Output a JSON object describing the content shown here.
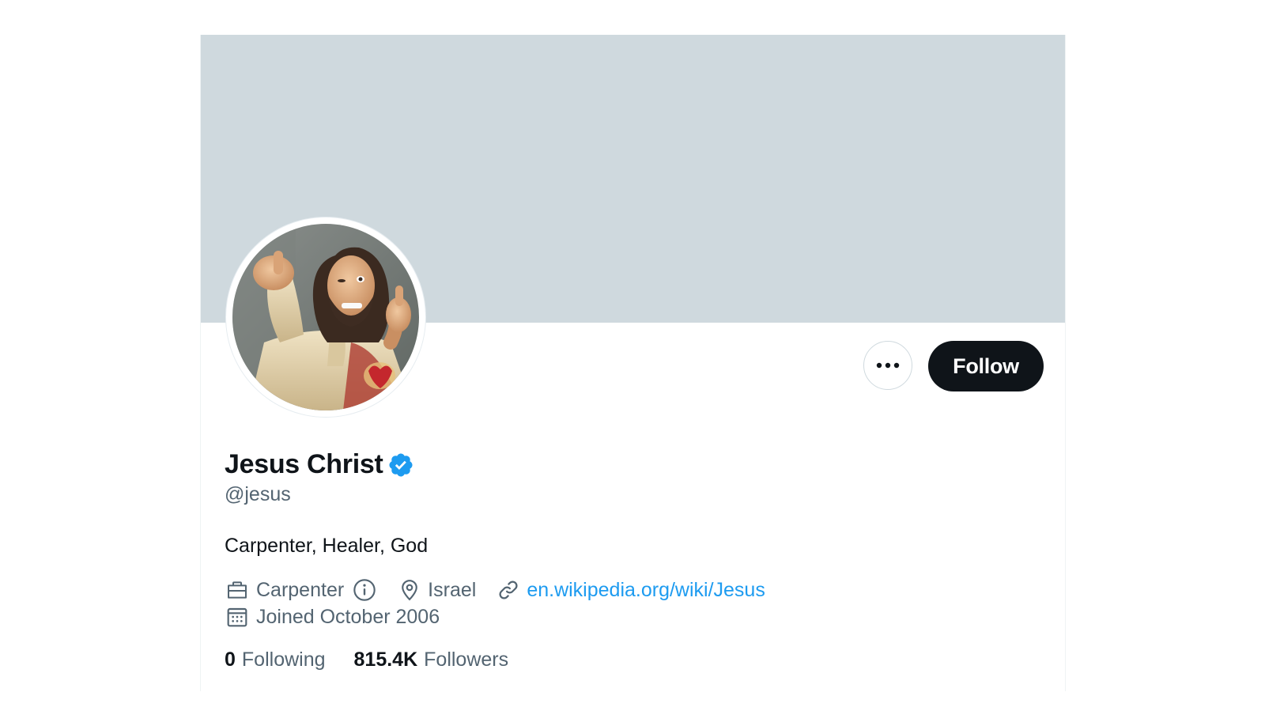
{
  "profile": {
    "display_name": "Jesus Christ",
    "verified": true,
    "handle": "@jesus",
    "bio": "Carpenter, Healer, God",
    "profession": "Carpenter",
    "location": "Israel",
    "website": "en.wikipedia.org/wiki/Jesus",
    "joined": "Joined October 2006"
  },
  "actions": {
    "more_icon": "ellipsis-icon",
    "follow_label": "Follow"
  },
  "stats": {
    "following_count": "0",
    "following_label": "Following",
    "followers_count": "815.4K",
    "followers_label": "Followers"
  },
  "colors": {
    "banner": "#cfd9de",
    "verified": "#1d9bf0",
    "link": "#1d9bf0",
    "secondary_text": "#536471",
    "follow_button": "#0f1419"
  }
}
